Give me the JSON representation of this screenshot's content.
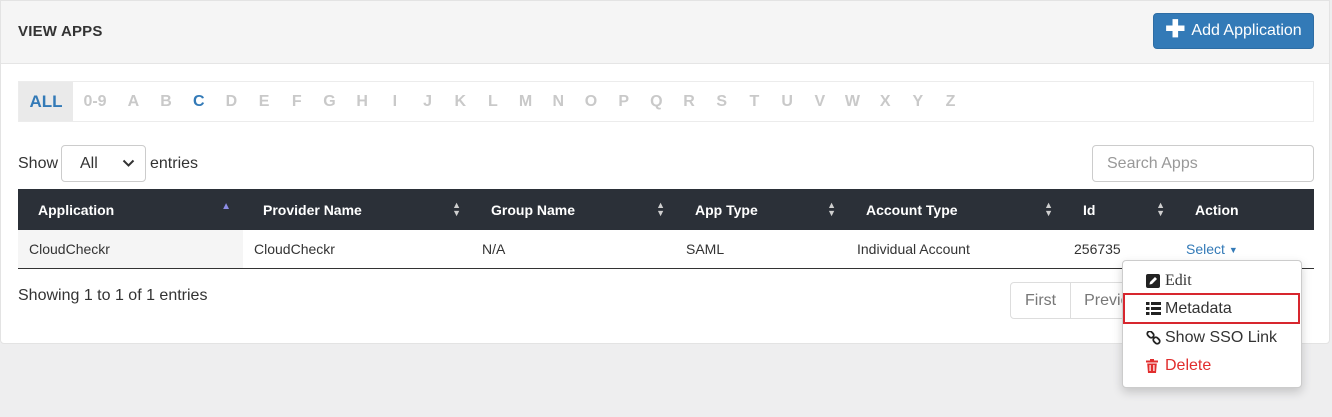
{
  "header": {
    "title": "VIEW APPS",
    "add_button_label": "Add Application",
    "accent_color": "#337ab7"
  },
  "alphabet_filter": {
    "items": [
      "ALL",
      "0-9",
      "A",
      "B",
      "C",
      "D",
      "E",
      "F",
      "G",
      "H",
      "I",
      "J",
      "K",
      "L",
      "M",
      "N",
      "O",
      "P",
      "Q",
      "R",
      "S",
      "T",
      "U",
      "V",
      "W",
      "X",
      "Y",
      "Z"
    ],
    "selected": "ALL",
    "highlighted": "C"
  },
  "length_control": {
    "prefix": "Show",
    "selected": "All",
    "suffix": "entries"
  },
  "search": {
    "placeholder": "Search Apps",
    "value": ""
  },
  "table": {
    "columns": [
      "Application",
      "Provider Name",
      "Group Name",
      "App Type",
      "Account Type",
      "Id",
      "Action"
    ],
    "rows": [
      {
        "application": "CloudCheckr",
        "provider_name": "CloudCheckr",
        "group_name": "N/A",
        "app_type": "SAML",
        "account_type": "Individual Account",
        "id": "256735",
        "action": "Select"
      }
    ]
  },
  "footer": {
    "info": "Showing 1 to 1 of 1 entries",
    "pagination": {
      "first": "First",
      "prev": "Previous"
    }
  },
  "action_menu": {
    "items": [
      {
        "label": "Edit",
        "icon": "pencil-square-icon"
      },
      {
        "label": "Metadata",
        "icon": "list-icon",
        "highlighted": true
      },
      {
        "label": "Show SSO Link",
        "icon": "link-icon"
      },
      {
        "label": "Delete",
        "icon": "trash-icon",
        "color": "#e12d2d"
      }
    ],
    "highlight_color": "#d7262e"
  }
}
